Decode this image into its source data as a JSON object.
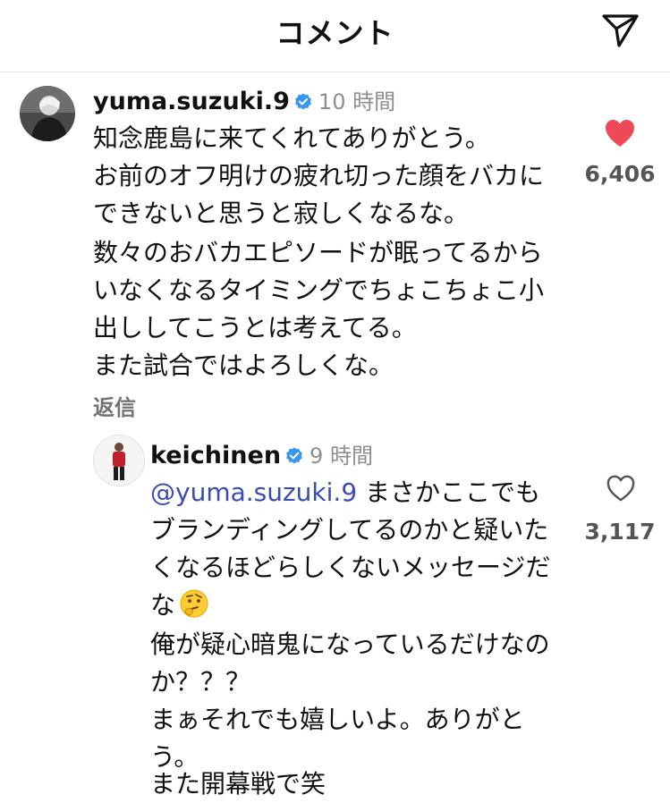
{
  "header": {
    "title": "コメント"
  },
  "comment": {
    "username": "yuma.suzuki.9",
    "time": "10 時間",
    "paragraphs": [
      "知念鹿島に来てくれてありがとう。",
      "お前のオフ明けの疲れ切った顔をバカにできないと思うと寂しくなるな。",
      "数々のおバカエピソードが眠ってるからいなくなるタイミングでちょこちょこ小出ししてこうとは考えてる。",
      "また試合ではよろしくな。"
    ],
    "like_count": "6,406",
    "reply_label": "返信"
  },
  "reply": {
    "username": "keichinen",
    "time": "9 時間",
    "mention": "@yuma.suzuki.9",
    "paragraphs": [
      "まさかここでもブランディングしてるのかと疑いたくなるほどらしくないメッセージだな",
      "俺が疑心暗鬼になっているだけなのか？？？",
      "まぁそれでも嬉しいよ。ありがとう。",
      "また開幕戦で笑"
    ],
    "emoji": "thinking-face",
    "like_count": "3,117"
  },
  "colors": {
    "like_red": "#ed4956",
    "verified_blue": "#3797f0",
    "mention_blue": "#3a4bb8",
    "muted_gray": "#8e8e8e"
  }
}
